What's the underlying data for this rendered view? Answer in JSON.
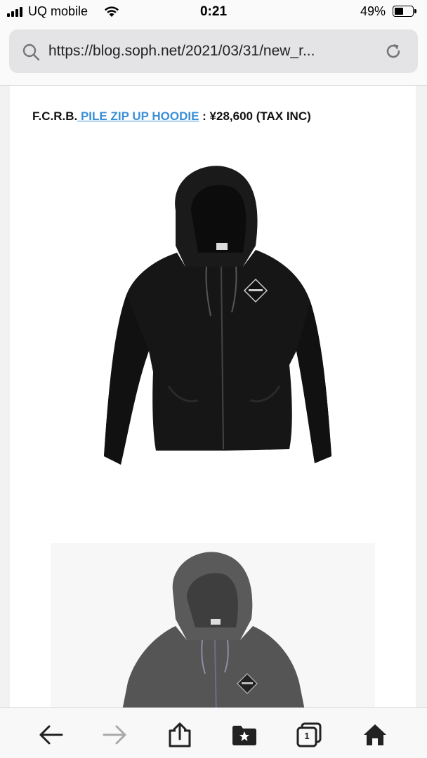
{
  "status_bar": {
    "carrier": "UQ mobile",
    "time": "0:21",
    "battery_percent": "49%",
    "battery_level": 0.49
  },
  "address_bar": {
    "url": "https://blog.soph.net/2021/03/31/new_r..."
  },
  "article": {
    "brand": "F.C.R.B.",
    "product_link": " PILE ZIP UP HOODIE",
    "price": " : ¥28,600 (TAX INC)",
    "link_color": "#3b8fd6"
  },
  "toolbar": {
    "tab_count": "1",
    "icons": [
      "back-arrow-icon",
      "forward-arrow-icon",
      "share-icon",
      "bookmarks-icon",
      "tabs-icon",
      "home-icon"
    ]
  }
}
